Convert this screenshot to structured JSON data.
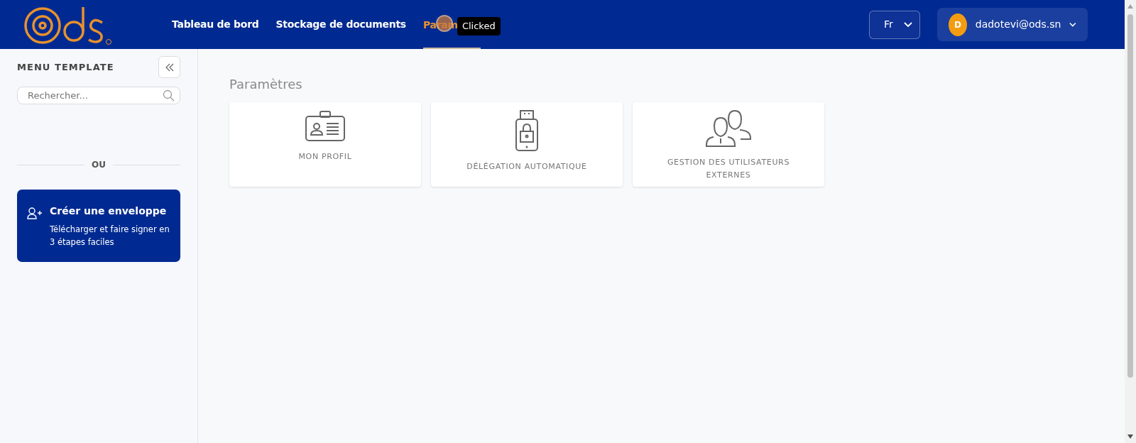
{
  "header": {
    "nav": [
      {
        "label": "Tableau de bord",
        "selected": false
      },
      {
        "label": "Stockage de documents",
        "selected": false
      },
      {
        "label": "Param",
        "selected": true
      }
    ],
    "tooltip": "Clicked",
    "language": "Fr",
    "user": {
      "initial": "D",
      "email": "dadotevi@ods.sn"
    }
  },
  "sidebar": {
    "title": "MENU TEMPLATE",
    "search": {
      "placeholder": "Rechercher..."
    },
    "divider": "OU",
    "create_card": {
      "title": "Créer une enveloppe",
      "text": "Télécharger et faire signer en 3 étapes faciles"
    }
  },
  "main": {
    "title": "Paramètres",
    "cards": [
      {
        "kind": "badge",
        "label": "MON PROFIL"
      },
      {
        "kind": "usb",
        "label": "DÉLÉGATION AUTOMATIQUE"
      },
      {
        "kind": "users",
        "label": "GESTION DES UTILISATEURS EXTERNES"
      }
    ]
  }
}
